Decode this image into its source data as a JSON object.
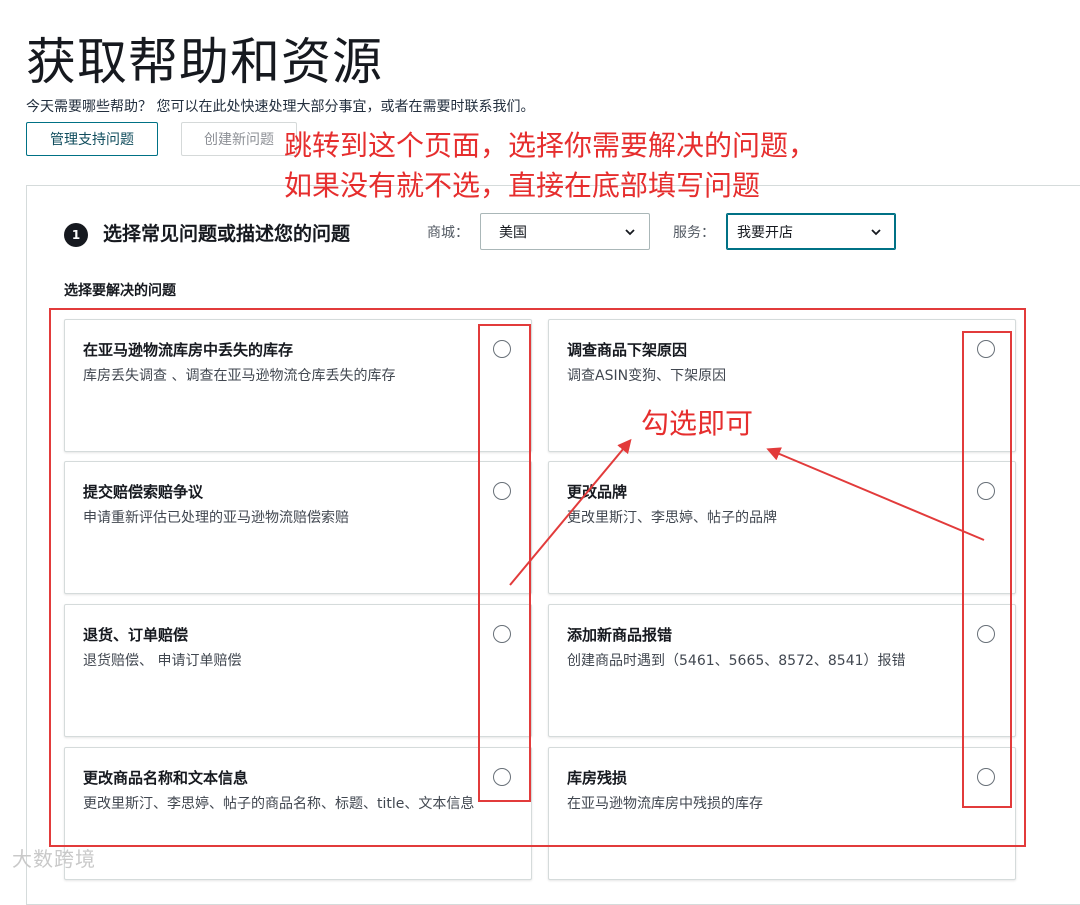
{
  "page": {
    "title": "获取帮助和资源",
    "subtitle": "今天需要哪些帮助？ 您可以在此处快速处理大部分事宜，或者在需要时联系我们。"
  },
  "actions": {
    "manage_label": "管理支持问题",
    "new_label": "创建新问题"
  },
  "step": {
    "number": "1",
    "title": "选择常见问题或描述您的问题",
    "marketplace_label": "商城：",
    "marketplace_value": "美国",
    "service_label": "服务：",
    "service_value": "我要开店"
  },
  "section_label": "选择要解决的问题",
  "issues": [
    {
      "title": "在亚马逊物流库房中丢失的库存",
      "desc": "库房丢失调查 、调查在亚马逊物流仓库丢失的库存"
    },
    {
      "title": "调查商品下架原因",
      "desc": "调查ASIN变狗、下架原因"
    },
    {
      "title": "提交赔偿索赔争议",
      "desc": "申请重新评估已处理的亚马逊物流赔偿索赔"
    },
    {
      "title": "更改品牌",
      "desc": "更改里斯汀、李思婷、帖子的品牌"
    },
    {
      "title": "退货、订单赔偿",
      "desc": "退货赔偿、 申请订单赔偿"
    },
    {
      "title": "添加新商品报错",
      "desc": "创建商品时遇到（5461、5665、8572、8541）报错"
    },
    {
      "title": "更改商品名称和文本信息",
      "desc": "更改里斯汀、李思婷、帖子的商品名称、标题、title、文本信息"
    },
    {
      "title": "库房残损",
      "desc": "在亚马逊物流库房中残损的库存"
    }
  ],
  "annotations": {
    "line1": "跳转到这个页面，选择你需要解决的问题，",
    "line2": "如果没有就不选，直接在底部填写问题",
    "check_hint": "勾选即可",
    "color": "#e23b3b"
  },
  "watermark": "大数跨境"
}
